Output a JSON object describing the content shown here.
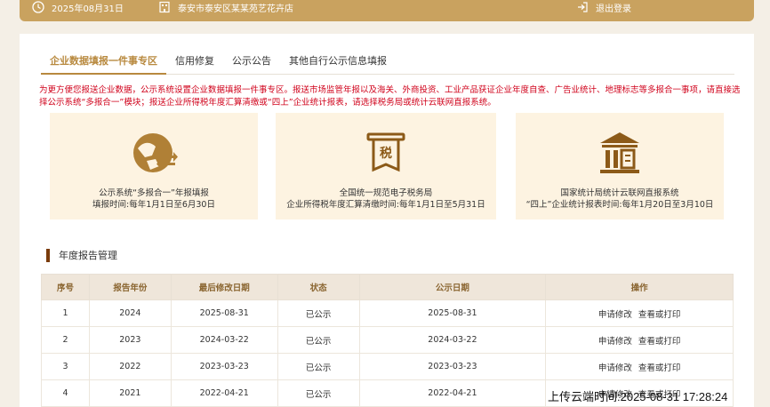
{
  "topbar": {
    "date": "2025年08月31日",
    "address": "泰安市泰安区某某苑艺花卉店",
    "logout": "退出登录",
    "accent": "#c9a25f"
  },
  "tabs": [
    {
      "label": "企业数据填报一件事专区",
      "active": true
    },
    {
      "label": "信用修复",
      "active": false
    },
    {
      "label": "公示公告",
      "active": false
    },
    {
      "label": "其他自行公示信息填报",
      "active": false
    }
  ],
  "notice": "为更方便您报送企业数据，公示系统设置企业数据填报一件事专区。报送市场监管年报以及海关、外商投资、工业产品获证企业年度自查、广告业统计、地理标志等多报合一事项，请直接选择公示系统“多报合一”模块；报送企业所得税年度汇算清缴或“四上”企业统计报表，请选择税务局或统计云联网直报系统。",
  "cards": [
    {
      "icon": "multi-report-icon",
      "line1": "公示系统“多报合一”年报填报",
      "line2": "填报时间:每年1月1日至6月30日"
    },
    {
      "icon": "tax-icon",
      "line1": "全国统一规范电子税务局",
      "line2": "企业所得税年度汇算清缴时间:每年1月1日至5月31日"
    },
    {
      "icon": "statistics-bureau-icon",
      "line1": "国家统计局统计云联网直报系统",
      "line2": "“四上”企业统计报表时间:每年1月20日至3月10日"
    }
  ],
  "section_title": "年度报告管理",
  "table": {
    "headers": [
      "序号",
      "报告年份",
      "最后修改日期",
      "状态",
      "公示日期",
      "操作"
    ],
    "rows": [
      {
        "no": "1",
        "year": "2024",
        "modified": "2025-08-31",
        "status": "已公示",
        "published": "2025-08-31",
        "op1": "申请修改",
        "op2": "查看或打印"
      },
      {
        "no": "2",
        "year": "2023",
        "modified": "2024-03-22",
        "status": "已公示",
        "published": "2024-03-22",
        "op1": "申请修改",
        "op2": "查看或打印"
      },
      {
        "no": "3",
        "year": "2022",
        "modified": "2023-03-23",
        "status": "已公示",
        "published": "2023-03-23",
        "op1": "申请修改",
        "op2": "查看或打印"
      },
      {
        "no": "4",
        "year": "2021",
        "modified": "2022-04-21",
        "status": "已公示",
        "published": "2022-04-21",
        "op1": "申请修改",
        "op2": "查看或打印"
      }
    ]
  },
  "watermark": "上传云端时间:2025-08-31 17:28:24"
}
